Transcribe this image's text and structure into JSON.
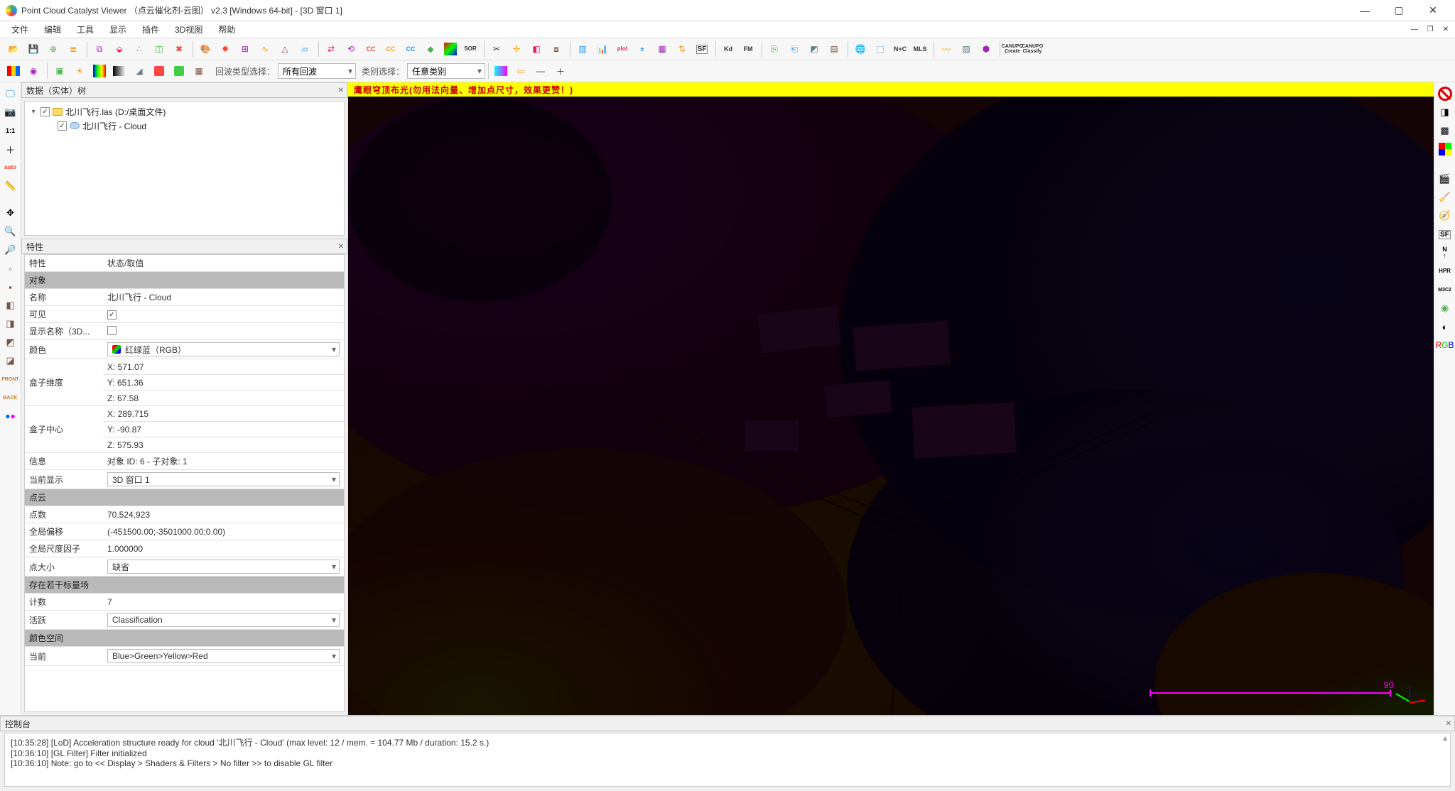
{
  "title": "Point Cloud Catalyst Viewer  （点云催化剂-云图）  v2.3  [Windows 64-bit] - [3D 窗口 1]",
  "menus": [
    "文件",
    "编辑",
    "工具",
    "显示",
    "插件",
    "3D视图",
    "帮助"
  ],
  "toolbar2": {
    "echo_label": "回波类型选择：",
    "echo_value": "所有回波",
    "class_label": "类别选择：",
    "class_value": "任意类别"
  },
  "tree": {
    "title": "数据（实体）树",
    "root": "北川飞行.las (D:/桌面文件)",
    "child": "北川飞行 - Cloud"
  },
  "props": {
    "title": "特性",
    "hdr_prop": "特性",
    "hdr_val": "状态/取值",
    "sec_object": "对象",
    "name_k": "名称",
    "name_v": "北川飞行 - Cloud",
    "visible_k": "可见",
    "showname_k": "显示名称（3D...",
    "color_k": "颜色",
    "color_v": "红绿蓝（RGB）",
    "boxdim_k": "盒子维度",
    "boxdim_x": "X: 571.07",
    "boxdim_y": "Y: 651.36",
    "boxdim_z": "Z: 67.58",
    "boxctr_k": "盒子中心",
    "boxctr_x": "X: 289.715",
    "boxctr_y": "Y: -90.87",
    "boxctr_z": "Z: 575.93",
    "info_k": "信息",
    "info_v": "对象 ID: 6 - 子对象: 1",
    "curdisp_k": "当前显示",
    "curdisp_v": "3D 窗口 1",
    "sec_cloud": "点云",
    "pts_k": "点数",
    "pts_v": "70,524,923",
    "shift_k": "全局偏移",
    "shift_v": "(-451500.00;-3501000.00;0.00)",
    "scale_k": "全局尺度因子",
    "scale_v": "1.000000",
    "psize_k": "点大小",
    "psize_v": "缺省",
    "sec_sf": "存在若干标量场",
    "count_k": "计数",
    "count_v": "7",
    "active_k": "活跃",
    "active_v": "Classification",
    "sec_cs": "颜色空间",
    "cur_k": "当前",
    "cur_v": "Blue>Green>Yellow>Red"
  },
  "viewport": {
    "banner": "鹰眼穹顶布光(勿用法向量、增加点尺寸，效果更赞！)",
    "scale_label": "90"
  },
  "console": {
    "title": "控制台",
    "lines": [
      "[10:35:28] [LoD] Acceleration structure ready for cloud '北川飞行 - Cloud' (max level: 12 / mem. = 104.77 Mb / duration: 15.2 s.)",
      "[10:36:10] [GL Filter] Filter initialized",
      "[10:36:10] Note: go to << Display > Shaders & Filters > No filter >> to disable GL filter"
    ]
  }
}
